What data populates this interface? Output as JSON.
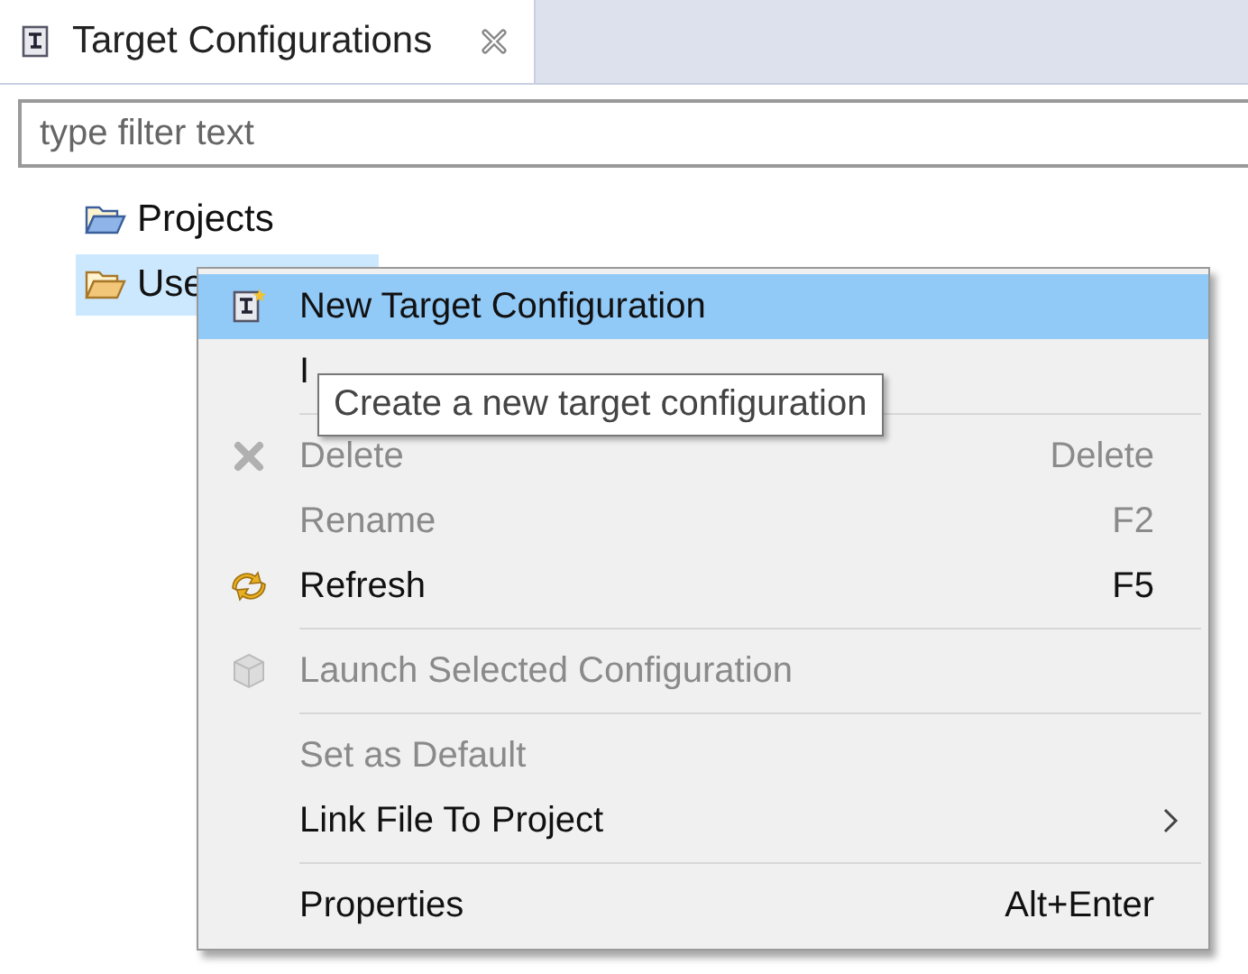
{
  "tab": {
    "title": "Target Configurations",
    "selected": true
  },
  "filter": {
    "placeholder": "type filter text"
  },
  "tree": [
    {
      "label": "Projects",
      "selected": false
    },
    {
      "label": "Use",
      "selected": true
    }
  ],
  "menu": [
    {
      "kind": "item",
      "label": "New Target Configuration",
      "selected": true,
      "disabled": false
    },
    {
      "kind": "item",
      "label": "I",
      "selected": false,
      "disabled": false
    },
    {
      "kind": "separator"
    },
    {
      "kind": "item",
      "label": "Delete",
      "shortcut": "Delete",
      "selected": false,
      "disabled": true
    },
    {
      "kind": "item",
      "label": "Rename",
      "shortcut": "F2",
      "selected": false,
      "disabled": true
    },
    {
      "kind": "item",
      "label": "Refresh",
      "shortcut": "F5",
      "selected": false,
      "disabled": false
    },
    {
      "kind": "separator"
    },
    {
      "kind": "item",
      "label": "Launch Selected Configuration",
      "selected": false,
      "disabled": true
    },
    {
      "kind": "separator"
    },
    {
      "kind": "item",
      "label": "Set as Default",
      "selected": false,
      "disabled": true
    },
    {
      "kind": "item",
      "label": "Link File To Project",
      "submenu": true,
      "selected": false,
      "disabled": false
    },
    {
      "kind": "separator"
    },
    {
      "kind": "item",
      "label": "Properties",
      "shortcut": "Alt+Enter",
      "selected": false,
      "disabled": false
    }
  ],
  "tooltip": "Create a new target configuration"
}
